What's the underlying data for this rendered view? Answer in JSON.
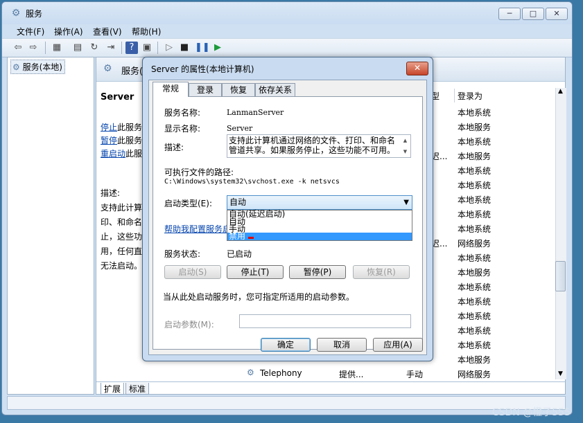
{
  "window": {
    "title": "服务",
    "min": "0",
    "max": "□",
    "close": "✕"
  },
  "menu": [
    "文件(F)",
    "操作(A)",
    "查看(V)",
    "帮助(H)"
  ],
  "toolbar_icons": [
    "back-icon",
    "forward-icon",
    "console-tree-icon",
    "properties-icon",
    "refresh-icon",
    "export-icon",
    "help-icon",
    "view-icon",
    "play-icon",
    "stop-icon",
    "pause-icon",
    "restart-icon"
  ],
  "tree": {
    "item": "服务(本地)"
  },
  "pane": {
    "title": "服务(本",
    "service_name": "Server",
    "links": [
      {
        "link": "停止",
        "rest": "此服务"
      },
      {
        "link": "暂停",
        "rest": "此服务"
      },
      {
        "link": "重启动",
        "rest": "此服"
      }
    ],
    "desc_label": "描述:",
    "desc_lines": [
      "支持此计算",
      "印、和命名",
      "止，这些功",
      "用，任何直",
      "无法启动。"
    ],
    "tabs": [
      "扩展",
      "标准"
    ]
  },
  "grid": {
    "type_header": "型",
    "logon_header": "登录为",
    "logon": [
      "本地系统",
      "本地服务",
      "本地系统",
      "本地服务",
      "本地系统",
      "本地系统",
      "本地系统",
      "本地系统",
      "本地系统",
      "网络服务",
      "本地系统",
      "本地服务",
      "本地系统",
      "本地系统",
      "本地系统",
      "本地系统",
      "本地系统",
      "本地服务",
      "网络服务"
    ],
    "start_partial": [
      "迟...",
      "迟..."
    ],
    "telephony": {
      "name": "Telephony",
      "desc": "提供...",
      "start": "手动",
      "logon": "网络服务"
    }
  },
  "dialog": {
    "title": "Server 的属性(本地计算机)",
    "close": "✕",
    "tabs": [
      "常规",
      "登录",
      "恢复",
      "依存关系"
    ],
    "service_name_label": "服务名称:",
    "service_name": "LanmanServer",
    "display_name_label": "显示名称:",
    "display_name": "Server",
    "description_label": "描述:",
    "description": "支持此计算机通过网络的文件、打印、和命名管道共享。如果服务停止，这些功能不可用。",
    "path_label": "可执行文件的路径:",
    "path": "C:\\Windows\\system32\\svchost.exe -k netsvcs",
    "startup_type_label": "启动类型(E):",
    "startup_type_value": "自动",
    "startup_options": [
      "自动(延迟启动)",
      "自动",
      "手动",
      "禁用"
    ],
    "help_link": "帮助我配置服务启",
    "status_label": "服务状态:",
    "status_value": "已启动",
    "buttons": {
      "start": "启动(S)",
      "stop": "停止(T)",
      "pause": "暂停(P)",
      "resume": "恢复(R)"
    },
    "hint": "当从此处启动服务时，您可指定所适用的启动参数。",
    "param_label": "启动参数(M):",
    "ok": "确定",
    "cancel": "取消",
    "apply": "应用(A)"
  },
  "watermark": "CSDN @橙子555"
}
